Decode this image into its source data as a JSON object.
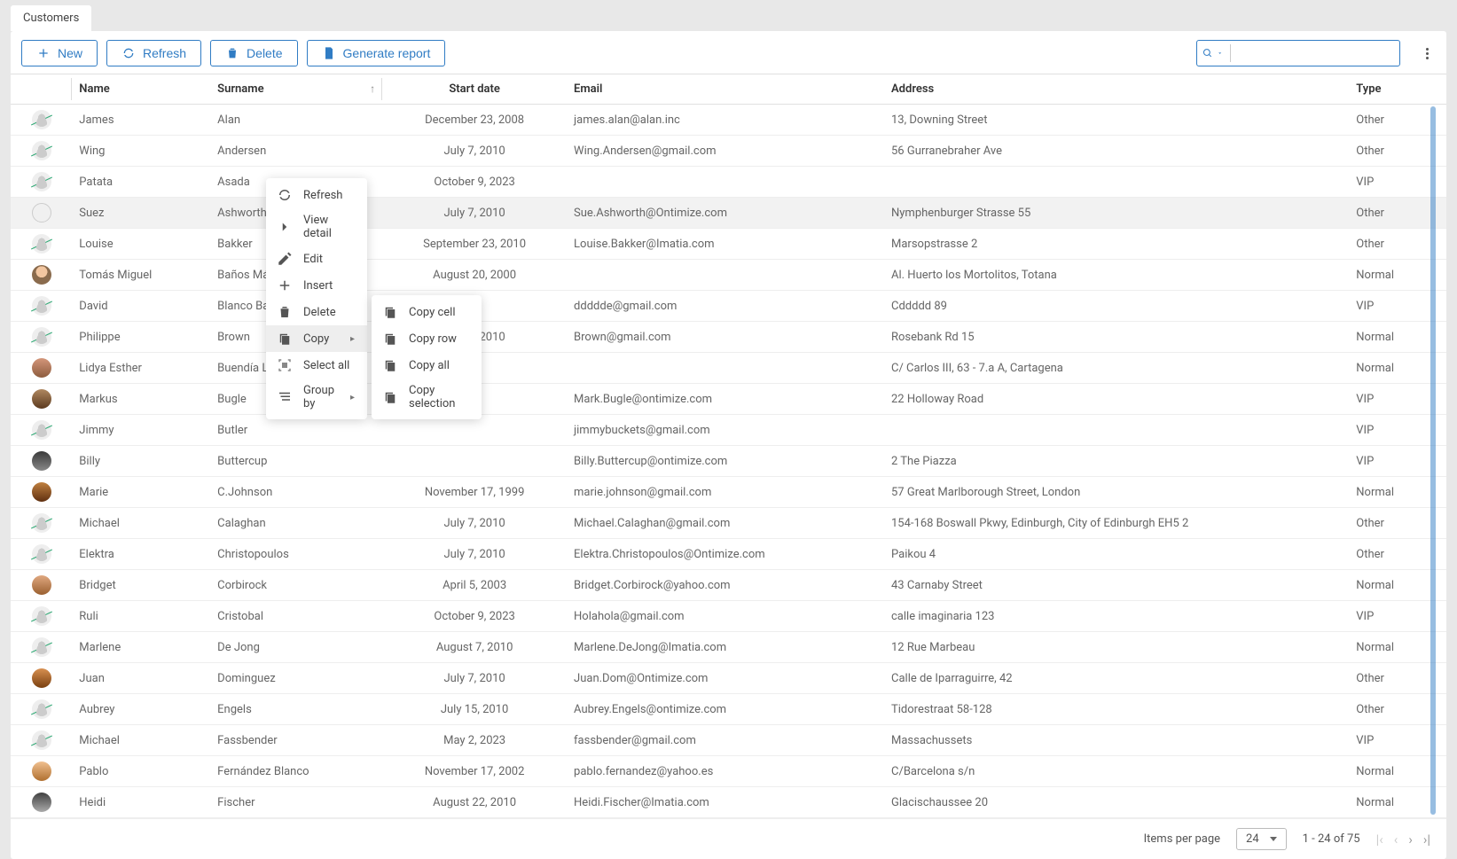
{
  "tab": {
    "label": "Customers"
  },
  "toolbar": {
    "new_label": "New",
    "refresh_label": "Refresh",
    "delete_label": "Delete",
    "report_label": "Generate report",
    "search_placeholder": ""
  },
  "columns": {
    "name": "Name",
    "surname": "Surname",
    "start_date": "Start date",
    "email": "Email",
    "address": "Address",
    "type": "Type"
  },
  "rows": [
    {
      "avatar": "placeholder slashed",
      "name": "James",
      "surname": "Alan",
      "date": "December 23, 2008",
      "email": "james.alan@alan.inc",
      "address": "13, Downing Street",
      "type": "Other"
    },
    {
      "avatar": "placeholder slashed",
      "name": "Wing",
      "surname": "Andersen",
      "date": "July 7, 2010",
      "email": "Wing.Andersen@gmail.com",
      "address": "56 Gurranebraher Ave",
      "type": "Other"
    },
    {
      "avatar": "placeholder slashed",
      "name": "Patata",
      "surname": "Asada",
      "date": "October 9, 2023",
      "email": "",
      "address": "",
      "type": "VIP"
    },
    {
      "avatar": "special",
      "name": "Suez",
      "surname": "Ashworth",
      "date": "July 7, 2010",
      "email": "Sue.Ashworth@Ontimize.com",
      "address": "Nymphenburger Strasse 55",
      "type": "Other",
      "highlight": true
    },
    {
      "avatar": "placeholder slashed",
      "name": "Louise",
      "surname": "Bakker",
      "date": "September 23, 2010",
      "email": "Louise.Bakker@Imatia.com",
      "address": "Marsopstrasse 2",
      "type": "Other"
    },
    {
      "avatar": "photo1",
      "name": "Tomás Miguel",
      "surname": "Baños Márquez",
      "date": "August 20, 2000",
      "email": "",
      "address": "Al. Huerto los Mortolitos, Totana",
      "type": "Normal"
    },
    {
      "avatar": "placeholder slashed",
      "name": "David",
      "surname": "Blanco Baladrón",
      "date": "",
      "email": "ddddde@gmail.com",
      "address": "Cddddd 89",
      "type": "VIP"
    },
    {
      "avatar": "placeholder slashed",
      "name": "Philippe",
      "surname": "Brown",
      "date": "July 7, 2010",
      "email": "Brown@gmail.com",
      "address": "Rosebank Rd 15",
      "type": "Normal"
    },
    {
      "avatar": "photo2",
      "name": "Lidya Esther",
      "surname": "Buendía Lorente",
      "date": "",
      "email": "",
      "address": "C/ Carlos III, 63 - 7.a A, Cartagena",
      "type": "Normal"
    },
    {
      "avatar": "photo3",
      "name": "Markus",
      "surname": "Bugle",
      "date": "",
      "email": "Mark.Bugle@ontimize.com",
      "address": "22 Holloway Road",
      "type": "VIP"
    },
    {
      "avatar": "placeholder slashed",
      "name": "Jimmy",
      "surname": "Butler",
      "date": "",
      "email": "jimmybuckets@gmail.com",
      "address": "",
      "type": "VIP"
    },
    {
      "avatar": "photo4",
      "name": "Billy",
      "surname": "Buttercup",
      "date": "",
      "email": "Billy.Buttercup@ontimize.com",
      "address": "2 The Piazza",
      "type": "VIP"
    },
    {
      "avatar": "photo5",
      "name": "Marie",
      "surname": "C.Johnson",
      "date": "November 17, 1999",
      "email": "marie.johnson@gmail.com",
      "address": "57 Great Marlborough Street, London",
      "type": "Normal"
    },
    {
      "avatar": "placeholder slashed",
      "name": "Michael",
      "surname": "Calaghan",
      "date": "July 7, 2010",
      "email": "Michael.Calaghan@gmail.com",
      "address": "154-168 Boswall Pkwy, Edinburgh, City of Edinburgh EH5 2",
      "type": "Other"
    },
    {
      "avatar": "placeholder slashed",
      "name": "Elektra",
      "surname": "Christopoulos",
      "date": "July 7, 2010",
      "email": "Elektra.Christopoulos@Ontimize.com",
      "address": "Paikou 4",
      "type": "Other"
    },
    {
      "avatar": "photo6",
      "name": "Bridget",
      "surname": "Corbirock",
      "date": "April 5, 2003",
      "email": "Bridget.Corbirock@yahoo.com",
      "address": "43 Carnaby Street",
      "type": "Normal"
    },
    {
      "avatar": "placeholder slashed",
      "name": "Ruli",
      "surname": "Cristobal",
      "date": "October 9, 2023",
      "email": "Holahola@gmail.com",
      "address": "calle imaginaria 123",
      "type": "VIP"
    },
    {
      "avatar": "placeholder slashed",
      "name": "Marlene",
      "surname": "De Jong",
      "date": "August 7, 2010",
      "email": "Marlene.DeJong@Imatia.com",
      "address": "12 Rue Marbeau",
      "type": "Normal"
    },
    {
      "avatar": "photo7",
      "name": "Juan",
      "surname": "Dominguez",
      "date": "July 7, 2010",
      "email": "Juan.Dom@Ontimize.com",
      "address": "Calle de Iparraguirre, 42",
      "type": "Other"
    },
    {
      "avatar": "placeholder slashed",
      "name": "Aubrey",
      "surname": "Engels",
      "date": "July 15, 2010",
      "email": "Aubrey.Engels@ontimize.com",
      "address": "Tidorestraat 58-128",
      "type": "Other"
    },
    {
      "avatar": "placeholder slashed",
      "name": "Michael",
      "surname": "Fassbender",
      "date": "May 2, 2023",
      "email": "fassbender@gmail.com",
      "address": "Massachussets",
      "type": "VIP"
    },
    {
      "avatar": "photo8",
      "name": "Pablo",
      "surname": "Fernández Blanco",
      "date": "November 17, 2002",
      "email": "pablo.fernandez@yahoo.es",
      "address": "C/Barcelona s/n",
      "type": "Normal"
    },
    {
      "avatar": "photo9",
      "name": "Heidi",
      "surname": "Fischer",
      "date": "August 22, 2010",
      "email": "Heidi.Fischer@Imatia.com",
      "address": "Glacischaussee 20",
      "type": "Normal"
    }
  ],
  "context_menu": {
    "refresh": "Refresh",
    "view_detail": "View detail",
    "edit": "Edit",
    "insert": "Insert",
    "delete": "Delete",
    "copy": "Copy",
    "select_all": "Select all",
    "group_by": "Group by",
    "sub": {
      "copy_cell": "Copy cell",
      "copy_row": "Copy row",
      "copy_all": "Copy all",
      "copy_selection": "Copy selection"
    }
  },
  "paginator": {
    "items_label": "Items per page",
    "page_size": "24",
    "range": "1 - 24 of 75"
  }
}
